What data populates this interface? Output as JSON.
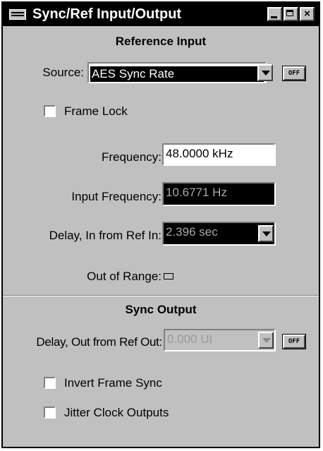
{
  "window": {
    "title": "Sync/Ref Input/Output",
    "min": "_",
    "max": "□",
    "close": "×"
  },
  "reference_input": {
    "heading": "Reference Input",
    "source_label": "Source:",
    "source_value": "AES Sync Rate",
    "source_off": "OFF",
    "frame_lock_label": "Frame Lock",
    "frame_lock_checked": false,
    "frequency_label": "Frequency:",
    "frequency_value": "48.0000 kHz",
    "input_frequency_label": "Input Frequency:",
    "input_frequency_value": "10.6771  Hz",
    "delay_label": "Delay, In from Ref In:",
    "delay_value": "2.396    sec",
    "out_of_range_label": "Out of Range:"
  },
  "sync_output": {
    "heading": "Sync Output",
    "delay_label": "Delay, Out from Ref Out:",
    "delay_value": "0.000    UI",
    "off": "OFF",
    "invert_label": "Invert Frame Sync",
    "invert_checked": false,
    "jitter_label": "Jitter Clock Outputs",
    "jitter_checked": false
  }
}
